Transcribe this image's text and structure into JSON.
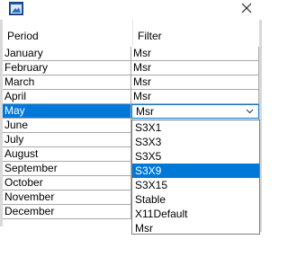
{
  "window": {
    "close_icon": "close-icon",
    "app_icon": "app-window-icon"
  },
  "grid": {
    "columns": [
      "Period",
      "Filter"
    ],
    "rows": [
      {
        "period": "January",
        "filter": "Msr"
      },
      {
        "period": "February",
        "filter": "Msr"
      },
      {
        "period": "March",
        "filter": "Msr"
      },
      {
        "period": "April",
        "filter": "Msr"
      },
      {
        "period": "May",
        "filter": "Msr"
      },
      {
        "period": "June",
        "filter": ""
      },
      {
        "period": "July",
        "filter": ""
      },
      {
        "period": "August",
        "filter": ""
      },
      {
        "period": "September",
        "filter": ""
      },
      {
        "period": "October",
        "filter": ""
      },
      {
        "period": "November",
        "filter": ""
      },
      {
        "period": "December",
        "filter": ""
      }
    ],
    "selected_row": "May"
  },
  "dropdown": {
    "current_value": "Msr",
    "options": [
      "S3X1",
      "S3X3",
      "S3X5",
      "S3X9",
      "S3X15",
      "Stable",
      "X11Default",
      "Msr"
    ],
    "highlighted": "S3X9"
  },
  "colors": {
    "selection": "#0078d7",
    "grid_line": "#a8a8a8"
  }
}
